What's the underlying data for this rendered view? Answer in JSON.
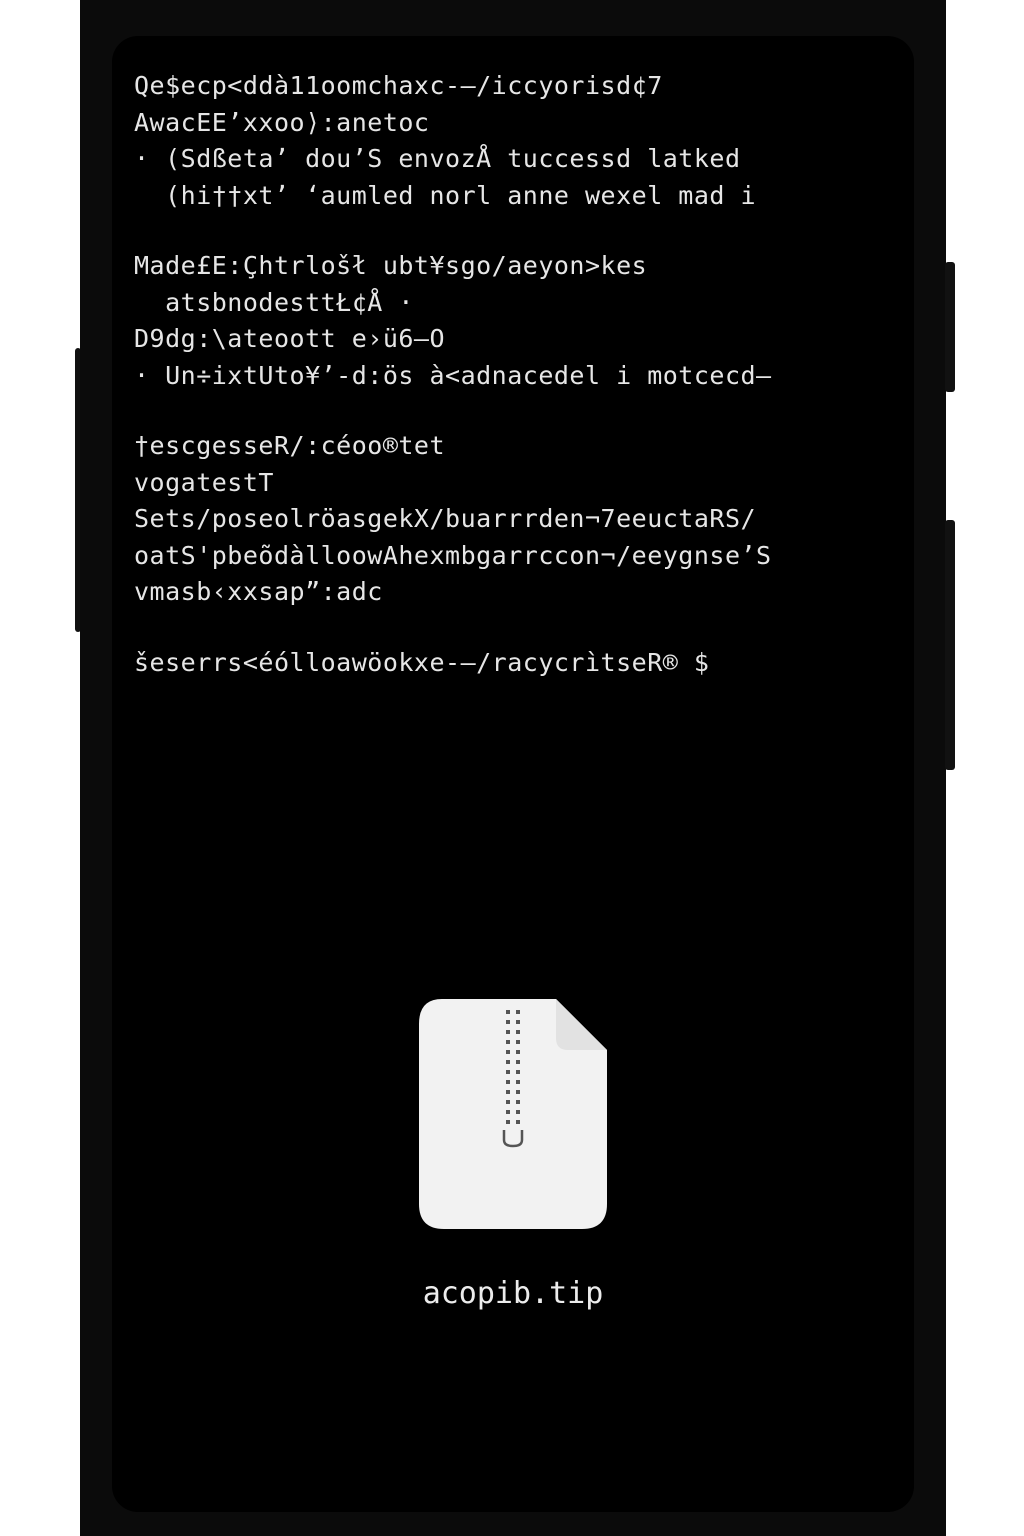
{
  "terminal": {
    "lines": [
      "Qe$ecp<ddà11oomchaxc-–/iccyorisd¢7",
      "AwacEE’xxoo⟩:anetoc",
      "· (Sdßetaʼ dou’S envozÅ tuccessd latked",
      "  (hi††xtʼ ʻaumled norl anne wexel mad i",
      "",
      "Made£E:Çhtrlošł ubt¥sgo/aeyon>kes",
      "  atsbnodesttŁ¢Å ·",
      "D9dg:\\ateoott e›ü6–O",
      "· Un÷ixtUto¥’-d:ös à<adnacedel i motcecd–",
      "",
      "†escgesseR/:céoo®tet",
      "vogatestT",
      "Sets/poseolröasgekX/buarrrden¬7eeuctaRS/",
      "oatS'pbeõdàlloowAhexmbgarrccon¬/eeygnse’S",
      "vmasb‹xxsap”:adc",
      "",
      "šeserrs<éólloawöokxe-–/racycrìtseR® $"
    ]
  },
  "file": {
    "name": "acopib.tip",
    "icon": "zip-file-icon"
  },
  "colors": {
    "screen_bg": "#000000",
    "bezel": "#0b0b0b",
    "text": "#e6e6e6",
    "icon_fill": "#f2f2f2"
  }
}
